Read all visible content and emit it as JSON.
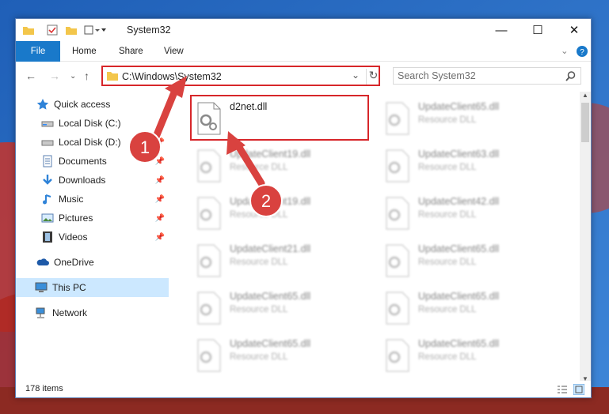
{
  "window": {
    "title": "System32"
  },
  "ribbon": {
    "tabs": [
      "File",
      "Home",
      "Share",
      "View"
    ]
  },
  "address": {
    "path": "C:\\Windows\\System32"
  },
  "search": {
    "placeholder": "Search System32"
  },
  "sidebar": {
    "items": [
      {
        "label": "Quick access",
        "icon": "star-icon"
      },
      {
        "label": "Local Disk (C:)",
        "icon": "drive-icon"
      },
      {
        "label": "Local Disk (D:)",
        "icon": "drive-icon"
      },
      {
        "label": "Documents",
        "icon": "documents-icon"
      },
      {
        "label": "Downloads",
        "icon": "downloads-icon"
      },
      {
        "label": "Music",
        "icon": "music-icon"
      },
      {
        "label": "Pictures",
        "icon": "pictures-icon"
      },
      {
        "label": "Videos",
        "icon": "videos-icon"
      },
      {
        "label": "OneDrive",
        "icon": "cloud-icon"
      },
      {
        "label": "This PC",
        "icon": "computer-icon"
      },
      {
        "label": "Network",
        "icon": "network-icon"
      }
    ]
  },
  "files": [
    {
      "name": "d2net.dll",
      "type": ""
    },
    {
      "name": "UpdateClient65.dll",
      "type": "Resource DLL"
    },
    {
      "name": "UpdateClient19.dll",
      "type": "Resource DLL"
    },
    {
      "name": "UpdateClient63.dll",
      "type": "Resource DLL"
    },
    {
      "name": "UpdateClient19.dll",
      "type": "Resource DLL"
    },
    {
      "name": "UpdateClient42.dll",
      "type": "Resource DLL"
    },
    {
      "name": "UpdateClient21.dll",
      "type": "Resource DLL"
    },
    {
      "name": "UpdateClient65.dll",
      "type": "Resource DLL"
    },
    {
      "name": "UpdateClient65.dll",
      "type": "Resource DLL"
    },
    {
      "name": "UpdateClient65.dll",
      "type": "Resource DLL"
    },
    {
      "name": "UpdateClient65.dll",
      "type": "Resource DLL"
    },
    {
      "name": "UpdateClient65.dll",
      "type": "Resource DLL"
    }
  ],
  "status": {
    "count": "178 items"
  },
  "annotations": {
    "step1": "1",
    "step2": "2",
    "color": "#d9423f"
  }
}
